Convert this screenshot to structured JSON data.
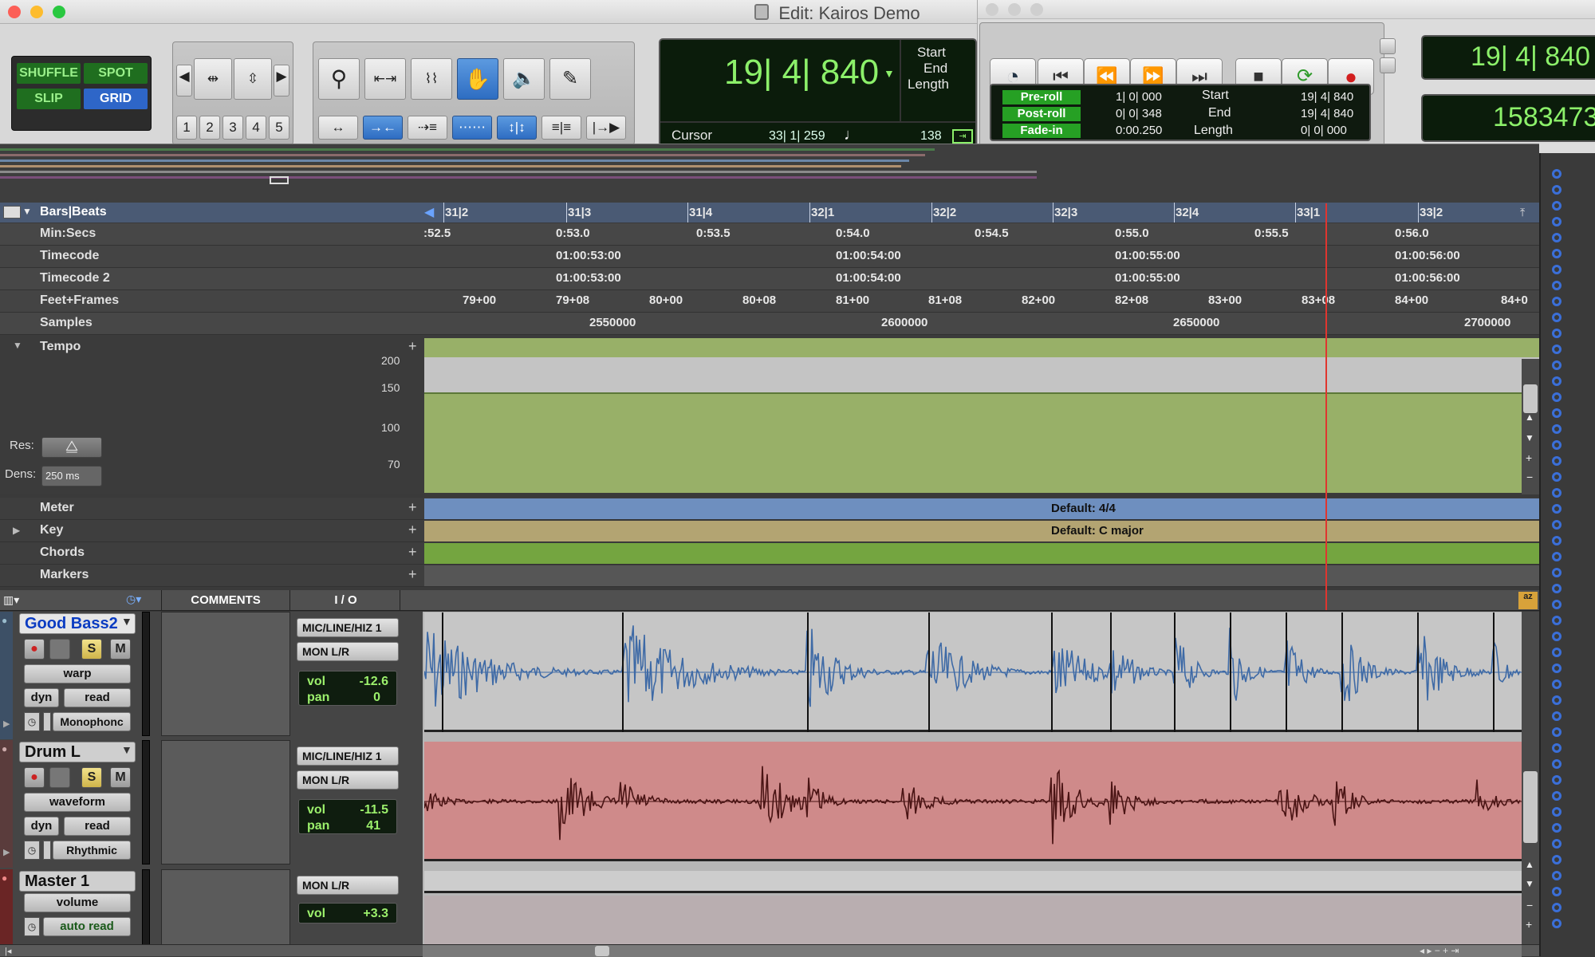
{
  "window": {
    "title": "Edit: Kairos Demo"
  },
  "toolbar": {
    "modes": {
      "shuffle": "SHUFFLE",
      "spot": "SPOT",
      "slip": "SLIP",
      "grid": "GRID"
    },
    "zoom_presets": [
      "1",
      "2",
      "3",
      "4",
      "5"
    ],
    "main_counter": "19| 4| 840",
    "counter_labels": {
      "start": "Start",
      "end": "End",
      "length": "Length"
    },
    "cursor_label": "Cursor",
    "cursor_value": "33| 1| 259",
    "tempo_value": "138"
  },
  "transport": {
    "preroll_label": "Pre-roll",
    "preroll_value": "1| 0| 000",
    "postroll_label": "Post-roll",
    "postroll_value": "0| 0| 348",
    "fadein_label": "Fade-in",
    "fadein_value": "0:00.250",
    "start_label": "Start",
    "start_value": "19| 4| 840",
    "end_label": "End",
    "end_value": "19| 4| 840",
    "length_label": "Length",
    "length_value": "0| 0| 000",
    "counter_main": "19| 4| 840",
    "counter_sub": "1583473"
  },
  "rulers": {
    "bars_beats": {
      "label": "Bars|Beats",
      "ticks": [
        "31|2",
        "31|3",
        "31|4",
        "32|1",
        "32|2",
        "32|3",
        "32|4",
        "33|1",
        "33|2"
      ]
    },
    "min_secs": {
      "label": "Min:Secs",
      "ticks": [
        ":52.5",
        "0:53.0",
        "0:53.5",
        "0:54.0",
        "0:54.5",
        "0:55.0",
        "0:55.5",
        "0:56.0"
      ]
    },
    "timecode": {
      "label": "Timecode",
      "ticks": [
        "01:00:53:00",
        "01:00:54:00",
        "01:00:55:00",
        "01:00:56:00"
      ]
    },
    "timecode2": {
      "label": "Timecode 2",
      "ticks": [
        "01:00:53:00",
        "01:00:54:00",
        "01:00:55:00",
        "01:00:56:00"
      ]
    },
    "feet_frames": {
      "label": "Feet+Frames",
      "ticks": [
        "79+00",
        "79+08",
        "80+00",
        "80+08",
        "81+00",
        "81+08",
        "82+00",
        "82+08",
        "83+00",
        "83+08",
        "84+00",
        "84+0"
      ]
    },
    "samples": {
      "label": "Samples",
      "ticks": [
        "2550000",
        "2600000",
        "2650000",
        "2700000"
      ]
    },
    "tempo": {
      "label": "Tempo",
      "scale": [
        "200",
        "150",
        "100",
        "70"
      ],
      "res_label": "Res:",
      "dens_label": "Dens:",
      "dens_value": "250 ms"
    },
    "meter": {
      "label": "Meter",
      "value": "Default: 4/4"
    },
    "key": {
      "label": "Key",
      "value": "Default: C major"
    },
    "chords": {
      "label": "Chords"
    },
    "markers": {
      "label": "Markers"
    }
  },
  "columns": {
    "comments": "COMMENTS",
    "io": "I / O"
  },
  "tracks": [
    {
      "name": "Good Bass2",
      "view": "warp",
      "dyn": "dyn",
      "automation": "read",
      "elastic": "Monophonc",
      "input": "MIC/LINE/HIZ 1",
      "output": "MON L/R",
      "vol_label": "vol",
      "vol": "-12.6",
      "pan_label": "pan",
      "pan": "0",
      "color": "#6b8fb8"
    },
    {
      "name": "Drum L",
      "view": "waveform",
      "dyn": "dyn",
      "automation": "read",
      "elastic": "Rhythmic",
      "input": "MIC/LINE/HIZ 1",
      "output": "MON L/R",
      "vol_label": "vol",
      "vol": "-11.5",
      "pan_label": "pan",
      "pan": "41",
      "color": "#cf8a8a"
    },
    {
      "name": "Master 1",
      "view": "volume",
      "automation": "auto read",
      "output": "MON L/R",
      "vol_label": "vol",
      "vol": "+3.3"
    }
  ],
  "track_buttons": {
    "solo": "S",
    "mute": "M"
  },
  "colors": {
    "tempo_green": "#98b068",
    "meter_blue": "#6e8fbf",
    "key_tan": "#b3a472",
    "chords_green": "#74a540",
    "playhead_red": "#e0352f",
    "lcd_green": "#8cf06a",
    "selection_blue": "#2e6dc2"
  }
}
